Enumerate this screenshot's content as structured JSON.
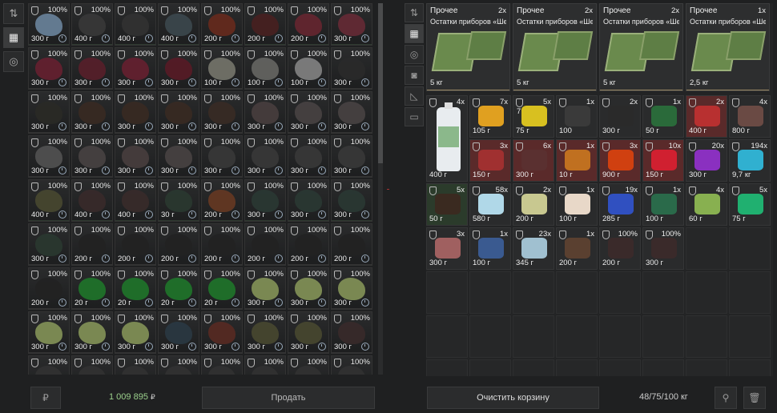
{
  "left_toolbar": [
    "sort-icon",
    "grid-view-icon",
    "filter-icon"
  ],
  "left_items": [
    [
      "100%",
      "300 г",
      "#6f8aa3",
      "#2f3a30"
    ],
    [
      "100%",
      "400 г",
      "#3a3a3a",
      "#2f3a30"
    ],
    [
      "100%",
      "400 г",
      "#333",
      "#2f3a30"
    ],
    [
      "100%",
      "400 г",
      "#3d4a50",
      "#2f3a30"
    ],
    [
      "100%",
      "200 г",
      "#6b2a1c",
      "#2f3a30"
    ],
    [
      "100%",
      "200 г",
      "#4a2020",
      "#2f3a30"
    ],
    [
      "100%",
      "200 г",
      "#6a2630",
      "#2f3a30"
    ],
    [
      "100%",
      "300 г",
      "#6a2a36",
      "#2f3a30"
    ],
    [
      "100%",
      "300 г",
      "#6a2030",
      "#333"
    ],
    [
      "100%",
      "300 г",
      "#5a1e2a",
      "#333"
    ],
    [
      "100%",
      "300 г",
      "#6a2030",
      "#333"
    ],
    [
      "100%",
      "300 г",
      "#5a1a26",
      "#333"
    ],
    [
      "100%",
      "100 г",
      "#7a7a70",
      "#333"
    ],
    [
      "100%",
      "100 г",
      "#6a6a66",
      "#333"
    ],
    [
      "100%",
      "100 г",
      "#888",
      "#333"
    ],
    [
      "100%",
      "300 г",
      "#2a2a2a",
      "#333"
    ],
    [
      "100%",
      "300 г",
      "#2a2a26",
      "#333"
    ],
    [
      "100%",
      "300 г",
      "#3a2a22",
      "#333"
    ],
    [
      "100%",
      "300 г",
      "#3a2a22",
      "#333"
    ],
    [
      "100%",
      "300 г",
      "#3a2a22",
      "#333"
    ],
    [
      "100%",
      "300 г",
      "#3a2c24",
      "#333"
    ],
    [
      "100%",
      "300 г",
      "#4a4040",
      "#333"
    ],
    [
      "100%",
      "300 г",
      "#4a4444",
      "#333"
    ],
    [
      "100%",
      "300 г",
      "#4a4444",
      "#333"
    ],
    [
      "100%",
      "300 г",
      "#555",
      "#333"
    ],
    [
      "100%",
      "300 г",
      "#4a4444",
      "#333"
    ],
    [
      "100%",
      "300 г",
      "#4a4040",
      "#333"
    ],
    [
      "100%",
      "300 г",
      "#4a4444",
      "#333"
    ],
    [
      "100%",
      "300 г",
      "#3a3a3a",
      "#333"
    ],
    [
      "100%",
      "300 г",
      "#3a3a3a",
      "#333"
    ],
    [
      "100%",
      "300 г",
      "#3a3a3a",
      "#333"
    ],
    [
      "100%",
      "300 г",
      "#3a3a3a",
      "#333"
    ],
    [
      "100%",
      "400 г",
      "#4a4a30",
      "#2f3a30"
    ],
    [
      "100%",
      "400 г",
      "#3a2a2a",
      "#2f3a30"
    ],
    [
      "100%",
      "400 г",
      "#3a2c2a",
      "#2f3a30"
    ],
    [
      "100%",
      "30 г",
      "#2a3a30",
      "#2f3a30"
    ],
    [
      "100%",
      "200 г",
      "#6a3a22",
      "#2f3a30"
    ],
    [
      "100%",
      "300 г",
      "#2a3a34",
      "#2f3a30"
    ],
    [
      "100%",
      "300 г",
      "#2a3a34",
      "#2f3a30"
    ],
    [
      "100%",
      "300 г",
      "#2a3a34",
      "#2f3a30"
    ],
    [
      "100%",
      "300 г",
      "#2a3a30",
      "#333"
    ],
    [
      "100%",
      "200 г",
      "#222",
      "#333"
    ],
    [
      "100%",
      "200 г",
      "#222",
      "#333"
    ],
    [
      "100%",
      "200 г",
      "#222",
      "#333"
    ],
    [
      "100%",
      "200 г",
      "#222",
      "#333"
    ],
    [
      "100%",
      "200 г",
      "#222",
      "#333"
    ],
    [
      "100%",
      "200 г",
      "#222",
      "#333"
    ],
    [
      "100%",
      "200 г",
      "#222",
      "#333"
    ],
    [
      "100%",
      "200 г",
      "#222",
      "#333"
    ],
    [
      "100%",
      "20 г",
      "#1f7a2a",
      "#333"
    ],
    [
      "100%",
      "20 г",
      "#1f7a2a",
      "#333"
    ],
    [
      "100%",
      "20 г",
      "#1f7a2a",
      "#333"
    ],
    [
      "100%",
      "20 г",
      "#1f7a2a",
      "#333"
    ],
    [
      "100%",
      "300 г",
      "#8a9a5a",
      "#333"
    ],
    [
      "100%",
      "300 г",
      "#8a9a5a",
      "#333"
    ],
    [
      "100%",
      "300 г",
      "#8a9a5a",
      "#333"
    ],
    [
      "100%",
      "300 г",
      "#8a9a5a",
      "#333"
    ],
    [
      "100%",
      "300 г",
      "#8a9a5a",
      "#333"
    ],
    [
      "100%",
      "300 г",
      "#8a9a5a",
      "#333"
    ],
    [
      "100%",
      "300 г",
      "#2a3a44",
      "#333"
    ],
    [
      "100%",
      "300 г",
      "#5a2a22",
      "#333"
    ],
    [
      "100%",
      "300 г",
      "#4a4a30",
      "#333"
    ],
    [
      "100%",
      "300 г",
      "#4a4a30",
      "#333"
    ],
    [
      "100%",
      "300 г",
      "#3a2a2a",
      "#333"
    ],
    [
      "100%",
      "",
      "#333",
      "#333"
    ],
    [
      "100%",
      "",
      "#333",
      "#333"
    ],
    [
      "100%",
      "",
      "#333",
      "#333"
    ],
    [
      "100%",
      "",
      "#333",
      "#333"
    ],
    [
      "100%",
      "",
      "#333",
      "#333"
    ],
    [
      "100%",
      "",
      "#333",
      "#333"
    ],
    [
      "100%",
      "",
      "#333",
      "#333"
    ],
    [
      "100%",
      "",
      "#333",
      "#333"
    ]
  ],
  "right_toolbar": [
    "sort-icon",
    "grid-view-icon",
    "filter-icon",
    "camera-icon",
    "ruler-icon",
    "box-icon"
  ],
  "right_top": [
    {
      "cat": "Прочее",
      "cnt": "2x",
      "name": "Остатки приборов «Ше…",
      "w": "5 кг"
    },
    {
      "cat": "Прочее",
      "cnt": "2x",
      "name": "Остатки приборов «Ше…",
      "w": "5 кг"
    },
    {
      "cat": "Прочее",
      "cnt": "2x",
      "name": "Остатки приборов «Ше…",
      "w": "5 кг"
    },
    {
      "cat": "Прочее",
      "cnt": "1x",
      "name": "Остатки приборов «Ше…",
      "w": "2,5 кг"
    }
  ],
  "right_items": [
    {
      "cnt": "7x",
      "w": "105 г",
      "c": "#e0a020",
      "bg": "",
      "ul": "#666"
    },
    {
      "cnt": "5x",
      "w": "75 г",
      "c": "#d8c020",
      "bg": "",
      "ul": "#666",
      "tag": "7"
    },
    {
      "cnt": "1x",
      "w": "100",
      "c": "#3a3a3a",
      "bg": "",
      "ul": "#666"
    },
    {
      "cnt": "2x",
      "w": "300 г",
      "c": "#2a2a2a",
      "bg": "",
      "ul": "#666"
    },
    {
      "cnt": "1x",
      "w": "50 г",
      "c": "#2a6a3a",
      "bg": "",
      "ul": "#666"
    },
    {
      "cnt": "2x",
      "w": "400 г",
      "c": "#b83030",
      "bg": "red",
      "ul": "#666"
    },
    {
      "cnt": "4x",
      "w": "800 г",
      "c": "#6a4a44",
      "bg": "",
      "ul": "#666"
    },
    {
      "cnt": "3x",
      "w": "150 г",
      "c": "#a03030",
      "bg": "red",
      "ul": "#666"
    },
    {
      "cnt": "6x",
      "w": "300 г",
      "c": "#5a3030",
      "bg": "red",
      "ul": "#666"
    },
    {
      "cnt": "1x",
      "w": "10 г",
      "c": "#c07020",
      "bg": "red",
      "ul": "#666"
    },
    {
      "cnt": "3x",
      "w": "900 г",
      "c": "#d04010",
      "bg": "red",
      "ul": "#666"
    },
    {
      "cnt": "10x",
      "w": "150 г",
      "c": "#d02030",
      "bg": "red",
      "ul": "#666"
    },
    {
      "cnt": "20x",
      "w": "300 г",
      "c": "#8a30c0",
      "bg": "",
      "ul": "#666"
    },
    {
      "cnt": "194x",
      "w": "9,7 кг",
      "c": "#30b0d0",
      "bg": "",
      "ul": "#666"
    },
    {
      "cnt": "5x",
      "w": "50 г",
      "c": "#3a2a20",
      "bg": "green",
      "ul": "#666"
    },
    {
      "cnt": "58x",
      "w": "580 г",
      "c": "#b0d8e8",
      "bg": "",
      "ul": "#666"
    },
    {
      "cnt": "2x",
      "w": "200 г",
      "c": "#c8c890",
      "bg": "",
      "ul": "#666"
    },
    {
      "cnt": "1x",
      "w": "100 г",
      "c": "#e8d8c8",
      "bg": "",
      "ul": "#666"
    },
    {
      "cnt": "19x",
      "w": "285 г",
      "c": "#3050c0",
      "bg": "",
      "ul": "#666"
    },
    {
      "cnt": "1x",
      "w": "100 г",
      "c": "#2a6a4a",
      "bg": "",
      "ul": "#666"
    },
    {
      "cnt": "4x",
      "w": "60 г",
      "c": "#88b050",
      "bg": "",
      "ul": "#666"
    },
    {
      "cnt": "5x",
      "w": "75 г",
      "c": "#20b070",
      "bg": "",
      "ul": "#666"
    },
    {
      "cnt": "3x",
      "w": "300 г",
      "c": "#a06060",
      "bg": "",
      "ul": "#666"
    },
    {
      "cnt": "1x",
      "w": "100 г",
      "c": "#3a5a90",
      "bg": "",
      "ul": "#666"
    },
    {
      "cnt": "23x",
      "w": "345 г",
      "c": "#a0c0d0",
      "bg": "",
      "ul": "#666"
    },
    {
      "cnt": "1x",
      "w": "200 г",
      "c": "#5a4030",
      "bg": "",
      "ul": "#666"
    },
    {
      "cnt": "100%",
      "w": "200 г",
      "c": "#3a2a2a",
      "bg": "",
      "ul": "#666"
    },
    {
      "cnt": "100%",
      "w": "300 г",
      "c": "#3a2a2a",
      "bg": "",
      "ul": "#666"
    }
  ],
  "bottle": {
    "cnt": "4x",
    "w": "400 г"
  },
  "bottom": {
    "money": "1 009 895",
    "currency": "₽",
    "sell": "Продать",
    "clear": "Очистить корзину",
    "weight": "48/75/100 кг"
  }
}
